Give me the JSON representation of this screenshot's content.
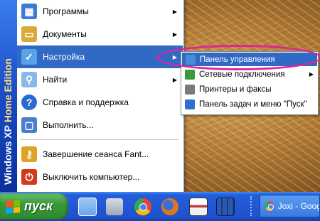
{
  "sidebar": {
    "brand": "Windows XP",
    "edition": "Home Edition"
  },
  "menu": {
    "items": [
      {
        "label": "Программы",
        "icon": "programs-icon",
        "has_submenu": true,
        "icon_color": "#3b7bd6"
      },
      {
        "label": "Документы",
        "icon": "documents-icon",
        "has_submenu": true,
        "icon_color": "#d9a93a"
      },
      {
        "label": "Настройка",
        "icon": "control-panel-icon",
        "has_submenu": true,
        "selected": true,
        "icon_color": "#5aa2e6"
      },
      {
        "label": "Найти",
        "icon": "search-icon",
        "has_submenu": true,
        "icon_color": "#8ab8e8"
      },
      {
        "label": "Справка и поддержка",
        "icon": "help-icon",
        "has_submenu": false,
        "icon_color": "#2a6ad1"
      },
      {
        "label": "Выполнить...",
        "icon": "run-icon",
        "has_submenu": false,
        "icon_color": "#4a7fd0"
      },
      {
        "label": "Завершение сеанса Fant...",
        "icon": "logoff-icon",
        "has_submenu": false,
        "icon_color": "#e0a32a"
      },
      {
        "label": "Выключить компьютер...",
        "icon": "shutdown-icon",
        "has_submenu": false,
        "icon_color": "#d13a1a"
      }
    ]
  },
  "submenu": {
    "items": [
      {
        "label": "Панель управления",
        "selected": true,
        "icon": "control-panel-icon",
        "icon_color": "#4c8ad8"
      },
      {
        "label": "Сетевые подключения",
        "has_submenu": true,
        "icon": "network-icon",
        "icon_color": "#3b9a3b"
      },
      {
        "label": "Принтеры и факсы",
        "icon": "printer-icon",
        "icon_color": "#7a7a7a"
      },
      {
        "label": "Панель задач и меню \"Пуск\"",
        "icon": "taskbar-icon",
        "icon_color": "#2f6fd3"
      }
    ]
  },
  "taskbar": {
    "start_label": "пуск",
    "quick_launch": [
      {
        "name": "show-desktop-icon",
        "color": "#6aa4e8"
      },
      {
        "name": "network-computer-icon",
        "color": "#9aa8b8"
      },
      {
        "name": "chrome-icon",
        "color": "#e8c23a"
      },
      {
        "name": "firefox-icon",
        "color": "#e0761f"
      },
      {
        "name": "save-disk-icon",
        "color": "#c03a3a"
      },
      {
        "name": "server-rack-icon",
        "color": "#2a5ab0"
      }
    ],
    "task_button": {
      "label": "Joxi - Google",
      "icon": "chrome-icon"
    }
  },
  "colors": {
    "highlight": "#316ac5",
    "annotation": "#e0249b"
  }
}
